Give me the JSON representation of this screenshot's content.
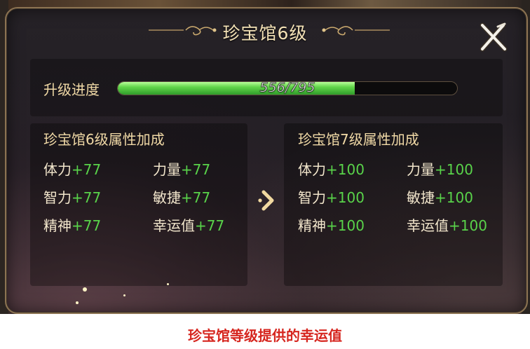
{
  "title": "珍宝馆6级",
  "progress": {
    "label": "升级进度",
    "current": 556,
    "max": 795,
    "text": "556/795"
  },
  "current_level": {
    "title": "珍宝馆6级属性加成",
    "attributes": [
      {
        "name": "体力",
        "value": "+77"
      },
      {
        "name": "力量",
        "value": "+77"
      },
      {
        "name": "智力",
        "value": "+77"
      },
      {
        "name": "敏捷",
        "value": "+77"
      },
      {
        "name": "精神",
        "value": "+77"
      },
      {
        "name": "幸运值",
        "value": "+77"
      }
    ]
  },
  "next_level": {
    "title": "珍宝馆7级属性加成",
    "attributes": [
      {
        "name": "体力",
        "value": "+100"
      },
      {
        "name": "力量",
        "value": "+100"
      },
      {
        "name": "智力",
        "value": "+100"
      },
      {
        "name": "敏捷",
        "value": "+100"
      },
      {
        "name": "精神",
        "value": "+100"
      },
      {
        "name": "幸运值",
        "value": "+100"
      }
    ]
  },
  "icons": {
    "close": "close-icon",
    "arrow": "chevron-right-icon"
  },
  "colors": {
    "attribute_value": "#59d34a",
    "progress_fill": "#62d64a",
    "label_gold": "#f0d9a6",
    "caption": "#d6261f"
  },
  "caption": "珍宝馆等级提供的幸运值"
}
